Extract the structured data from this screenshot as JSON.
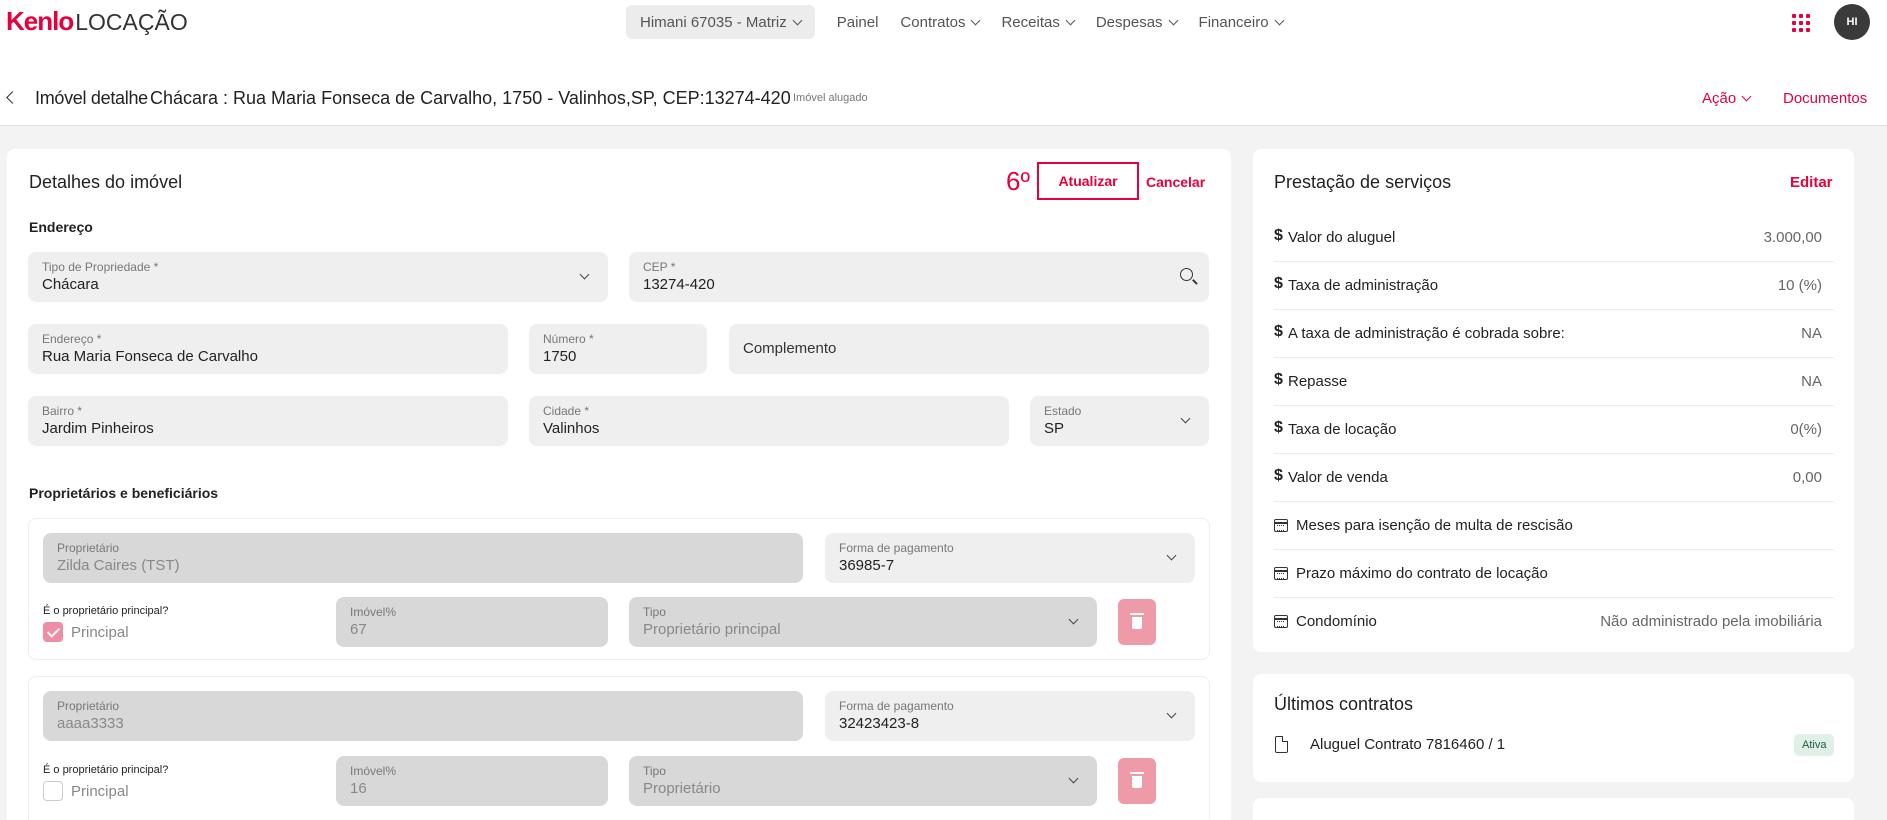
{
  "brand": {
    "name": "Kenlo",
    "product": "LOCAÇÃO"
  },
  "nav": {
    "branch": "Himani 67035 - Matriz",
    "items": [
      "Painel",
      "Contratos",
      "Receitas",
      "Despesas",
      "Financeiro"
    ],
    "avatar": "HI"
  },
  "header": {
    "title": "Imóvel detalhe",
    "address": "Chácara : Rua Maria Fonseca de Carvalho, 1750 - Valinhos,SP, CEP:13274-420",
    "status": "Imóvel alugado",
    "action": "Ação",
    "documents": "Documentos"
  },
  "details": {
    "title": "Detalhes do imóvel",
    "step_marker": "6º",
    "update_label": "Atualizar",
    "cancel_label": "Cancelar",
    "address_section": "Endereço",
    "fields": {
      "tipo": {
        "label": "Tipo de Propriedade *",
        "value": "Chácara"
      },
      "cep": {
        "label": "CEP *",
        "value": "13274-420"
      },
      "endereco": {
        "label": "Endereço *",
        "value": "Rua Maria Fonseca de Carvalho"
      },
      "numero": {
        "label": "Número *",
        "value": "1750"
      },
      "complemento": {
        "placeholder": "Complemento"
      },
      "bairro": {
        "label": "Bairro *",
        "value": "Jardim Pinheiros"
      },
      "cidade": {
        "label": "Cidade *",
        "value": "Valinhos"
      },
      "estado": {
        "label": "Estado",
        "value": "SP"
      }
    },
    "owners_section": "Proprietários e beneficiários",
    "owners": [
      {
        "owner_label": "Proprietário",
        "owner_value": "Zilda Caires (TST)",
        "payment_label": "Forma de pagamento",
        "payment_value": "36985-7",
        "principal_question": "É o proprietário principal?",
        "principal_label": "Principal",
        "share_label": "Imóvel%",
        "share_value": "67",
        "type_label": "Tipo",
        "type_value": "Proprietário principal"
      },
      {
        "owner_label": "Proprietário",
        "owner_value": "aaaa3333",
        "payment_label": "Forma de pagamento",
        "payment_value": "32423423-8",
        "principal_question": "É o proprietário principal?",
        "principal_label": "Principal",
        "share_label": "Imóvel%",
        "share_value": "16",
        "type_label": "Tipo",
        "type_value": "Proprietário"
      }
    ]
  },
  "services": {
    "title": "Prestação de serviços",
    "edit_label": "Editar",
    "currency_icon": "$",
    "rows": [
      {
        "icon": "dollar-icon",
        "name": "Valor do aluguel",
        "value": "3.000,00"
      },
      {
        "icon": "dollar-icon",
        "name": "Taxa de administração",
        "value": "10 (%)"
      },
      {
        "icon": "dollar-icon",
        "name": "A taxa de administração é cobrada sobre:",
        "value": "NA"
      },
      {
        "icon": "dollar-icon",
        "name": "Repasse",
        "value": "NA"
      },
      {
        "icon": "dollar-icon",
        "name": "Taxa de locação",
        "value": "0(%)"
      },
      {
        "icon": "dollar-icon",
        "name": "Valor de venda",
        "value": "0,00"
      },
      {
        "icon": "calendar-icon",
        "name": "Meses para isenção de multa de rescisão",
        "value": ""
      },
      {
        "icon": "calendar-icon",
        "name": "Prazo máximo do contrato de locação",
        "value": ""
      },
      {
        "icon": "calendar-icon",
        "name": "Condomínio",
        "value": "Não administrado pela imobiliária"
      }
    ]
  },
  "contracts": {
    "title": "Últimos contratos",
    "items": [
      {
        "name": "Aluguel Contrato 7816460 / 1",
        "status": "Ativa"
      }
    ]
  },
  "colors": {
    "accent": "#e6003c",
    "badge_bg": "#dff1e7"
  }
}
